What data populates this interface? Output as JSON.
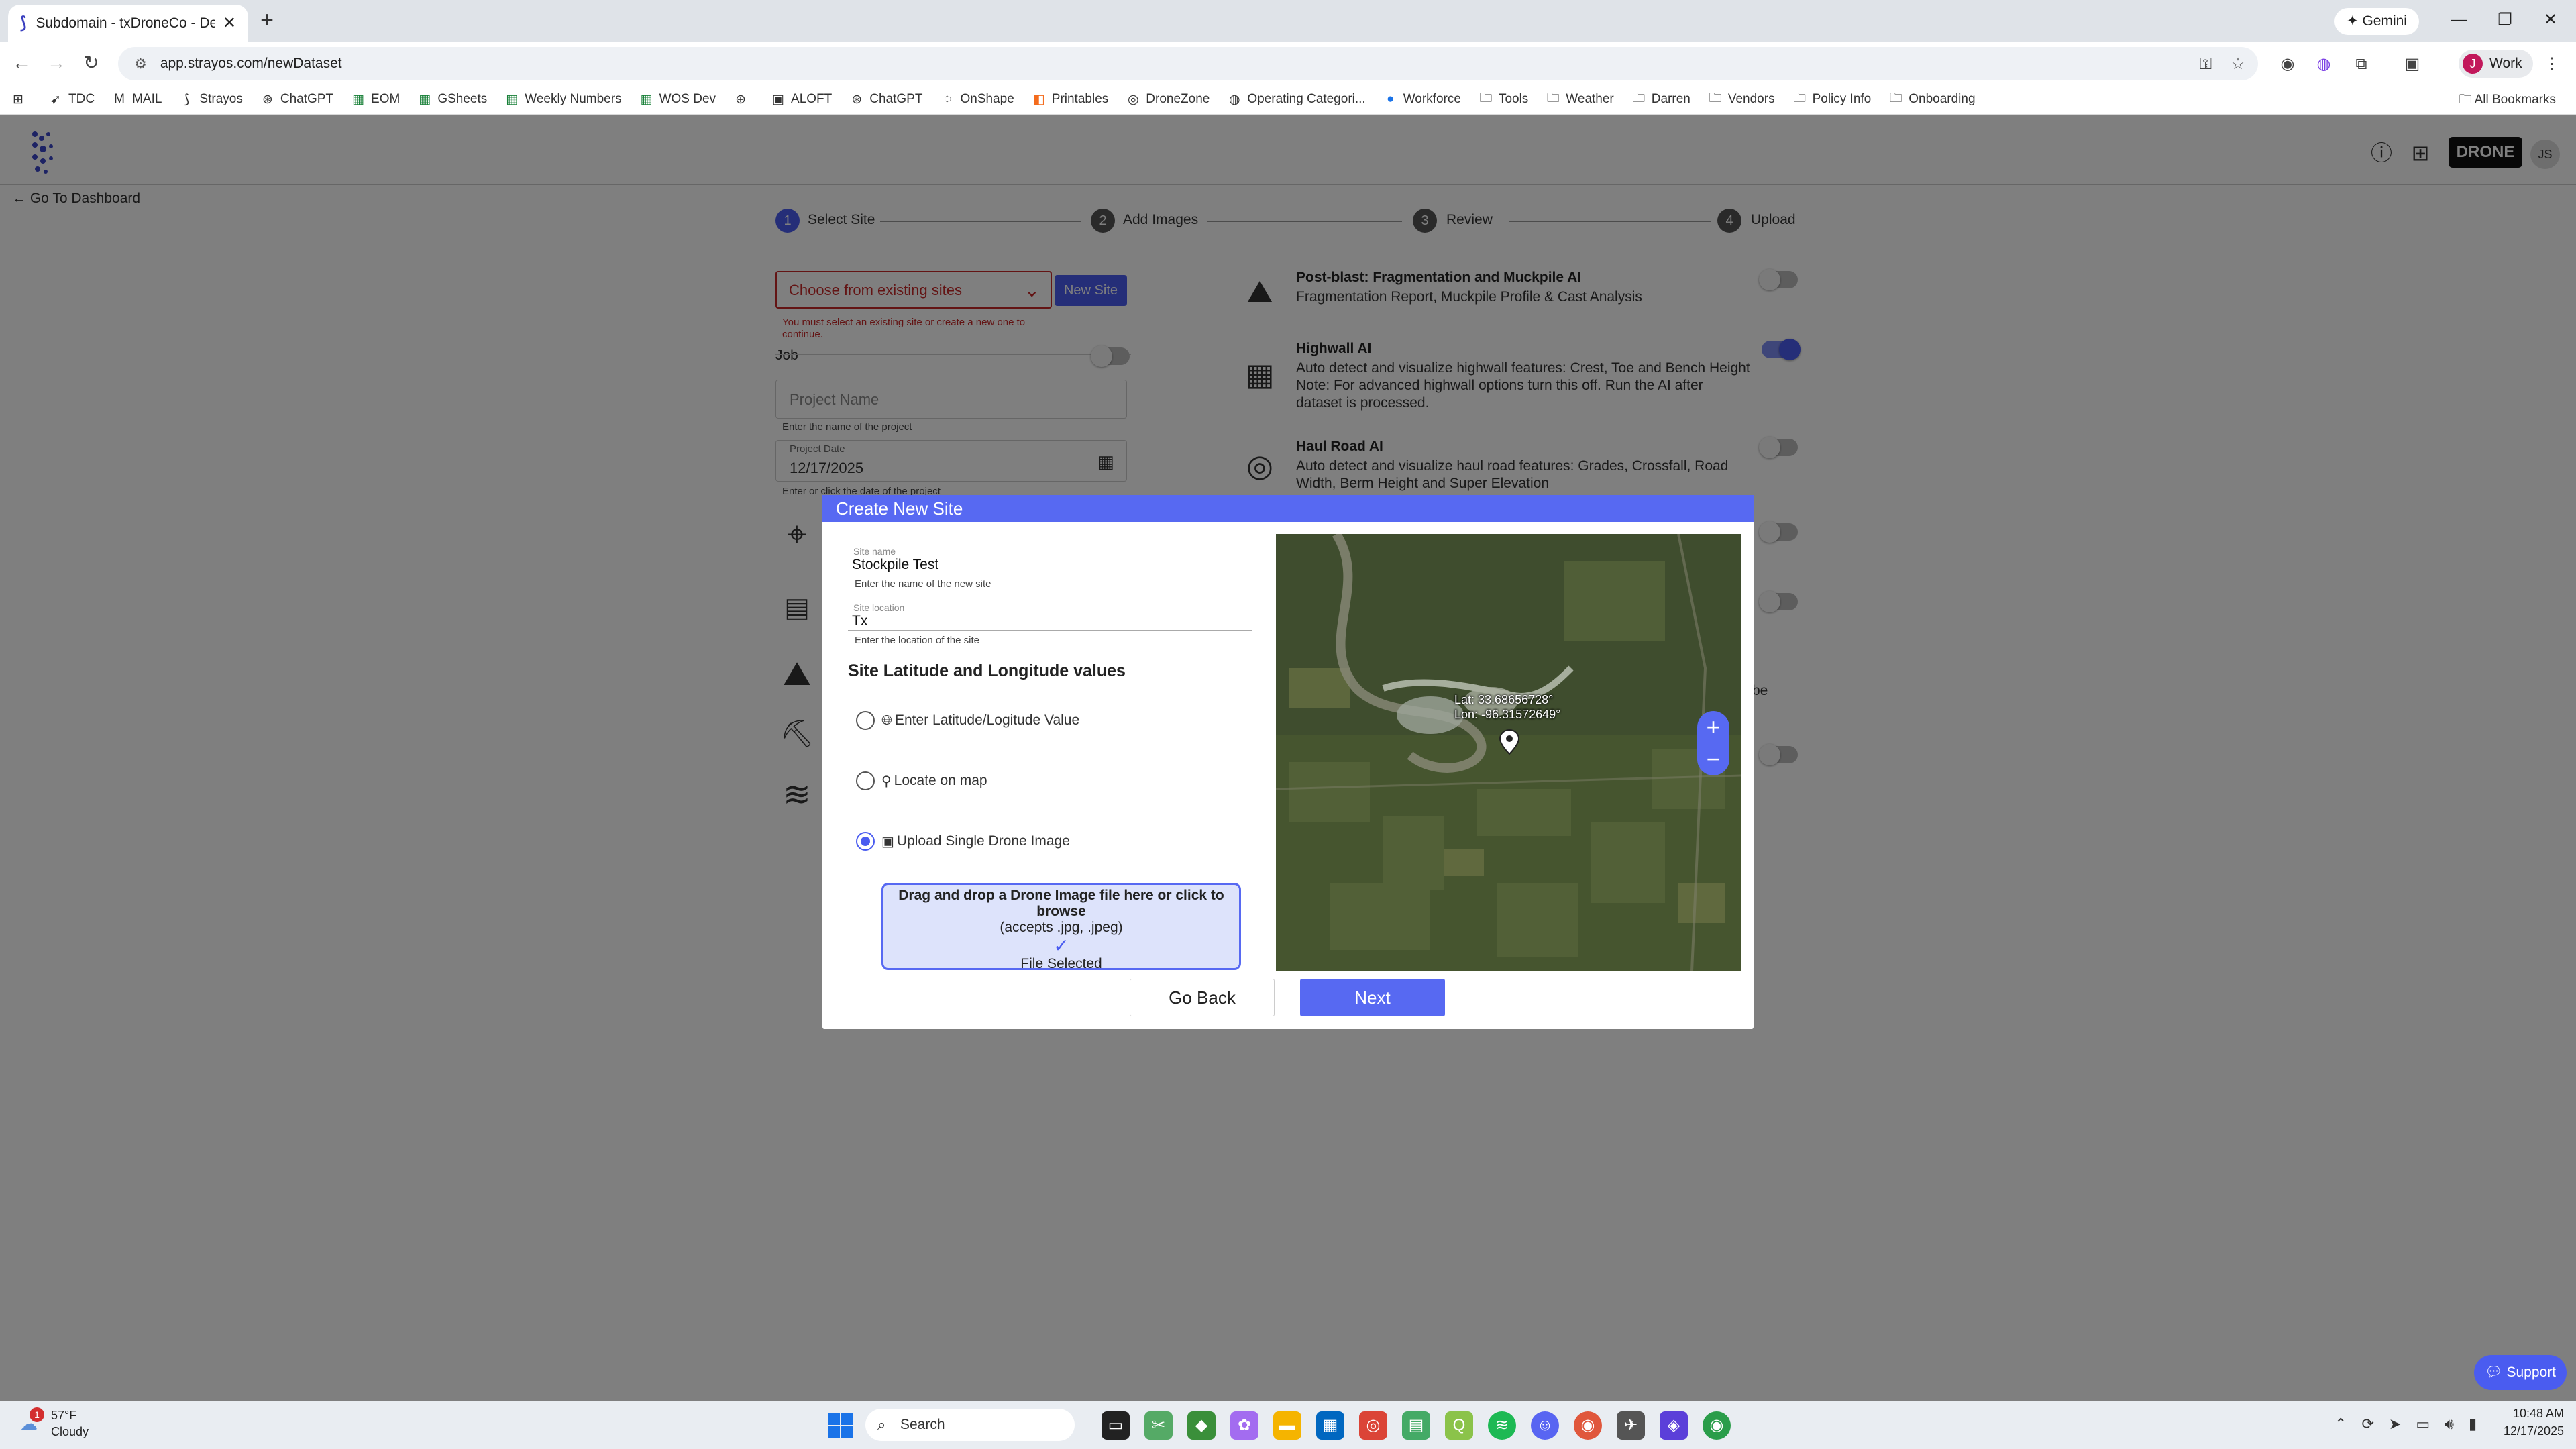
{
  "browser": {
    "tab_title": "Subdomain - txDroneCo - Dem",
    "gemini_label": "Gemini",
    "url": "app.strayos.com/newDataset",
    "profile_label": "Work",
    "profile_initial": "J",
    "bookmarks": [
      {
        "label": "TDC",
        "icon": "bookmark-icon"
      },
      {
        "label": "MAIL",
        "icon": "gmail-icon"
      },
      {
        "label": "Strayos",
        "icon": "strayos-icon"
      },
      {
        "label": "ChatGPT",
        "icon": "chatgpt-icon"
      },
      {
        "label": "EOM",
        "icon": "sheets-icon"
      },
      {
        "label": "GSheets",
        "icon": "sheets-icon"
      },
      {
        "label": "Weekly Numbers",
        "icon": "sheets-icon"
      },
      {
        "label": "WOS Dev",
        "icon": "sheets-icon"
      },
      {
        "label": "",
        "icon": "globe-icon"
      },
      {
        "label": "ALOFT",
        "icon": "aloft-icon"
      },
      {
        "label": "ChatGPT",
        "icon": "chatgpt-icon"
      },
      {
        "label": "OnShape",
        "icon": "onshape-icon"
      },
      {
        "label": "Printables",
        "icon": "printables-icon"
      },
      {
        "label": "DroneZone",
        "icon": "dronezone-icon"
      },
      {
        "label": "Operating Categori...",
        "icon": "faa-icon"
      },
      {
        "label": "Workforce",
        "icon": "workforce-icon"
      },
      {
        "label": "Tools",
        "icon": "folder-icon"
      },
      {
        "label": "Weather",
        "icon": "folder-icon"
      },
      {
        "label": "Darren",
        "icon": "folder-icon"
      },
      {
        "label": "Vendors",
        "icon": "folder-icon"
      },
      {
        "label": "Policy Info",
        "icon": "folder-icon"
      },
      {
        "label": "Onboarding",
        "icon": "folder-icon"
      }
    ],
    "all_bookmarks_label": "All Bookmarks"
  },
  "app": {
    "back_link": "Go To Dashboard",
    "user_initials": "JS",
    "brand_text": "DRONE",
    "steps": [
      {
        "num": "1",
        "label": "Select Site"
      },
      {
        "num": "2",
        "label": "Add Images"
      },
      {
        "num": "3",
        "label": "Review"
      },
      {
        "num": "4",
        "label": "Upload"
      }
    ],
    "site_select_placeholder": "Choose from existing sites",
    "new_site_button": "New Site",
    "site_error": "You must select an existing site or create a new one to continue.",
    "job_label": "Job",
    "project_name_placeholder": "Project Name",
    "project_name_help": "Enter the name of the project",
    "project_date_label": "Project Date",
    "project_date_value": "12/17/2025",
    "project_date_help": "Enter or click the date of the project",
    "options": [
      {
        "title": "Post-blast: Fragmentation and Muckpile AI",
        "desc": "Fragmentation Report, Muckpile Profile & Cast Analysis",
        "on": false
      },
      {
        "title": "Highwall AI",
        "desc": "Auto detect and visualize highwall features: Crest, Toe and Bench Height Note: For advanced highwall options turn this off. Run the AI after dataset is processed.",
        "on": true
      },
      {
        "title": "Haul Road AI",
        "desc": "Auto detect and visualize haul road features: Grades, Crossfall, Road Width, Berm Height and Super Elevation",
        "on": false
      }
    ],
    "partial_text": "be",
    "support_label": "Support"
  },
  "modal": {
    "title": "Create New Site",
    "site_name_label": "Site name",
    "site_name_value": "Stockpile Test",
    "site_name_help": "Enter the name of the new site",
    "site_location_label": "Site location",
    "site_location_value": "Tx",
    "site_location_help": "Enter the location of the site",
    "latlon_heading": "Site Latitude and Longitude values",
    "radio_options": [
      {
        "label": "Enter Latitude/Logitude Value",
        "icon": "globe-icon",
        "selected": false
      },
      {
        "label": "Locate on map",
        "icon": "pin-icon",
        "selected": false
      },
      {
        "label": "Upload Single Drone Image",
        "icon": "image-icon",
        "selected": true
      }
    ],
    "dropzone_line1": "Drag and drop a Drone Image file here or click to browse",
    "dropzone_line2": "(accepts .jpg, .jpeg)",
    "dropzone_status": "File Selected",
    "map_lat": "Lat: 33.68656728°",
    "map_lon": "Lon: -96.31572649°",
    "go_back_button": "Go Back",
    "next_button": "Next"
  },
  "taskbar": {
    "weather_temp": "57°F",
    "weather_desc": "Cloudy",
    "weather_badge": "1",
    "search_label": "Search",
    "time": "10:48 AM",
    "date": "12/17/2025"
  },
  "colors": {
    "accent": "#5769f2",
    "error": "#c62828"
  }
}
